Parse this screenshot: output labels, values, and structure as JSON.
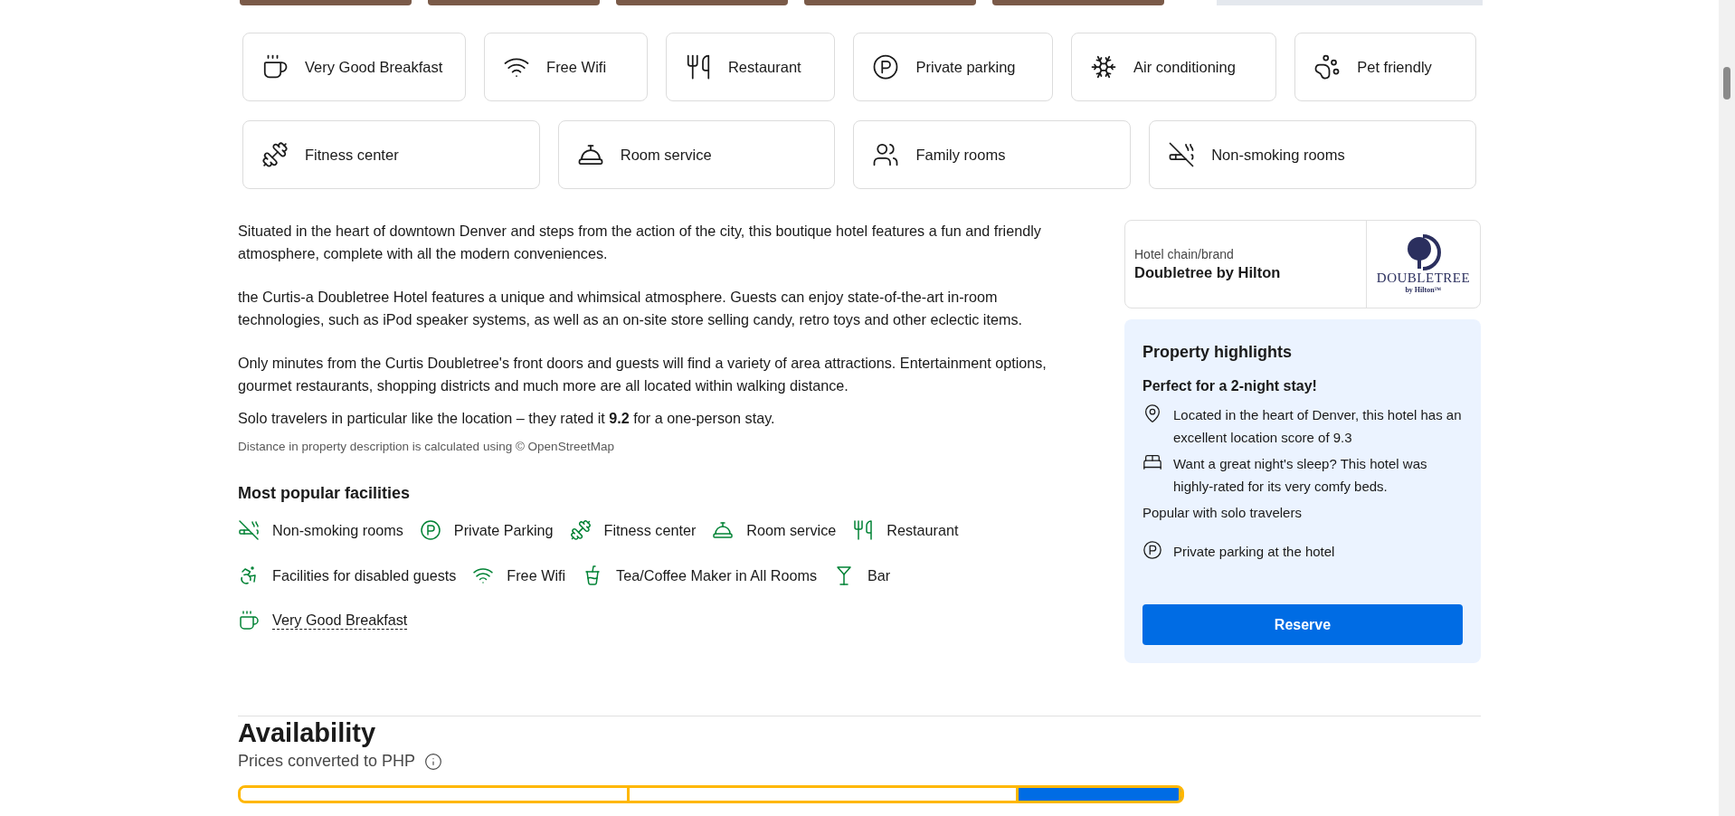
{
  "amenity_rows": [
    [
      {
        "kind": "breakfast",
        "label": "Very Good Breakfast"
      },
      {
        "kind": "wifi",
        "label": "Free Wifi"
      },
      {
        "kind": "restaurant",
        "label": "Restaurant"
      },
      {
        "kind": "parking",
        "label": "Private parking"
      },
      {
        "kind": "aircon",
        "label": "Air conditioning"
      },
      {
        "kind": "pet",
        "label": "Pet friendly"
      }
    ],
    [
      {
        "kind": "fitness",
        "label": "Fitness center"
      },
      {
        "kind": "roomservice",
        "label": "Room service"
      },
      {
        "kind": "family",
        "label": "Family rooms"
      },
      {
        "kind": "nosmoking",
        "label": "Non-smoking rooms"
      }
    ]
  ],
  "description": {
    "paragraphs": [
      "Situated in the heart of downtown Denver and steps from the action of the city, this boutique hotel features a fun and friendly atmosphere, complete with all the modern conveniences.",
      "the Curtis-a Doubletree Hotel features a unique and whimsical atmosphere. Guests can enjoy state-of-the-art in-room technologies, such as iPod speaker systems, as well as an on-site store selling candy, retro toys and other eclectic items.",
      "Only minutes from the Curtis Doubletree's front doors and guests will find a variety of area attractions. Entertainment options, gourmet restaurants, shopping districts and much more are all located within walking distance."
    ],
    "solo_note": "Solo travelers in particular like the location – they rated it **9.2** for a one-person stay.",
    "source_note": "Distance in property description is calculated using © OpenStreetMap"
  },
  "facilities": {
    "title": "Most popular facilities",
    "items": [
      {
        "kind": "nosmoking",
        "label": "Non-smoking rooms",
        "underlined": false
      },
      {
        "kind": "parking",
        "label": "Private Parking",
        "underlined": false
      },
      {
        "kind": "fitness",
        "label": "Fitness center",
        "underlined": false
      },
      {
        "kind": "roomservice",
        "label": "Room service",
        "underlined": false
      },
      {
        "kind": "restaurant",
        "label": "Restaurant",
        "underlined": false
      },
      {
        "kind": "accessible",
        "label": "Facilities for disabled guests",
        "underlined": false
      },
      {
        "kind": "wifi",
        "label": "Free Wifi",
        "underlined": false
      },
      {
        "kind": "teamaker",
        "label": "Tea/Coffee Maker in All Rooms",
        "underlined": false
      },
      {
        "kind": "bar",
        "label": "Bar",
        "underlined": false
      },
      {
        "kind": "breakfast",
        "label": "Very Good Breakfast",
        "underlined": true
      }
    ]
  },
  "brand": {
    "label": "Hotel chain/brand",
    "name": "Doubletree by Hilton",
    "logo_text": "DOUBLETREE",
    "logo_subtext": "by Hilton™"
  },
  "highlights": {
    "title": "Property highlights",
    "subtitle": "Perfect for a 2-night stay!",
    "items": [
      {
        "kind": "location",
        "text": "Located in the heart of Denver, this hotel has an excellent location score of 9.3"
      },
      {
        "kind": "bed",
        "text": "Want a great night's sleep? This hotel was highly-rated for its very comfy beds."
      },
      {
        "kind": "plain",
        "text": "Popular with solo travelers"
      },
      {
        "kind": "parking",
        "text": "Private parking at the hotel"
      }
    ],
    "button": "Reserve"
  },
  "availability": {
    "title": "Availability",
    "subtitle": "Prices converted to PHP"
  }
}
